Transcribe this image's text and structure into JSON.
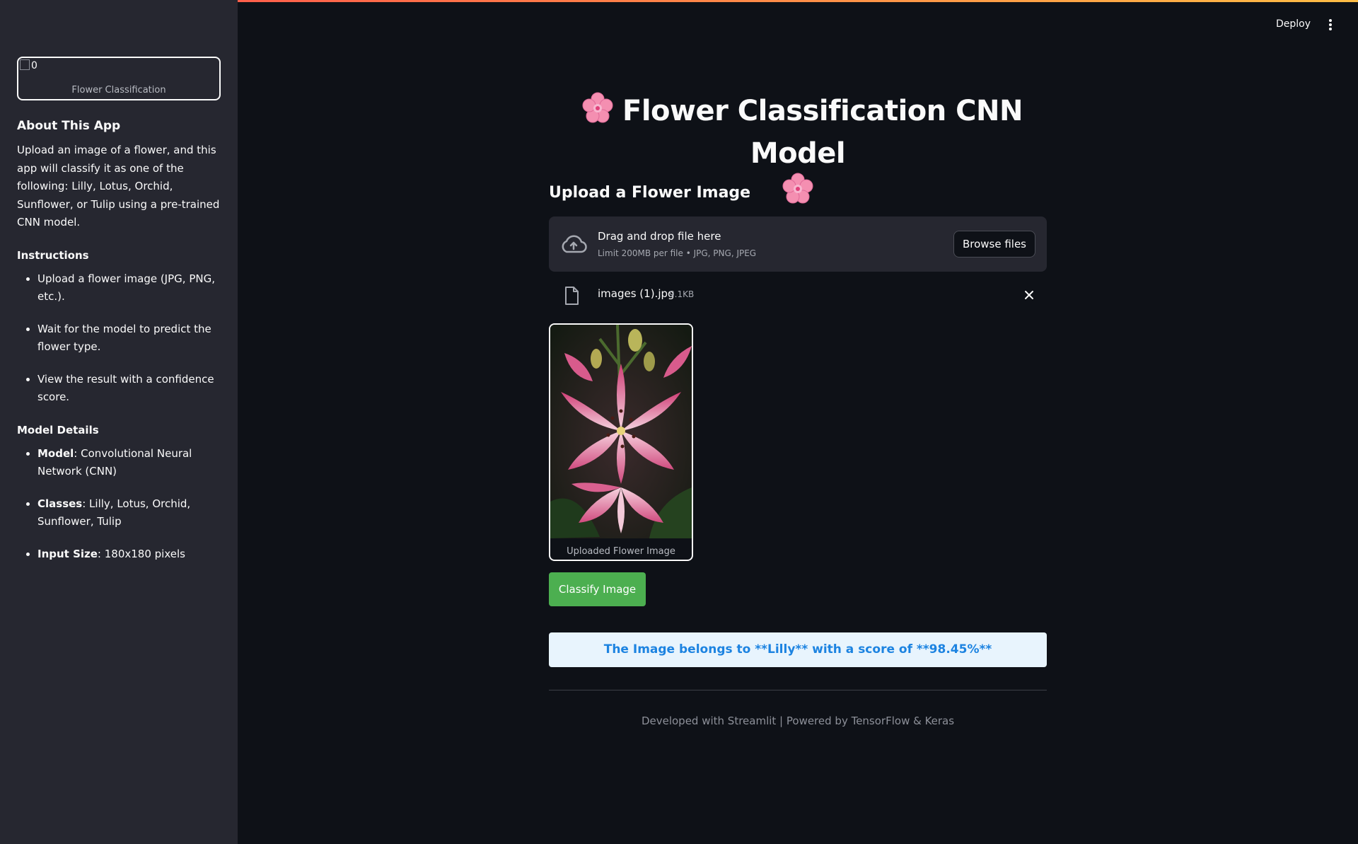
{
  "topbar": {
    "deploy_label": "Deploy"
  },
  "sidebar": {
    "logo": {
      "alt_text": "0",
      "caption": "Flower Classification"
    },
    "about": {
      "heading": "About This App",
      "text": "Upload an image of a flower, and this app will classify it as one of the following: Lilly, Lotus, Orchid, Sunflower, or Tulip using a pre-trained CNN model."
    },
    "instructions": {
      "heading": "Instructions",
      "items": [
        "Upload a flower image (JPG, PNG, etc.).",
        "Wait for the model to predict the flower type.",
        "View the result with a confidence score."
      ]
    },
    "model_details": {
      "heading": "Model Details",
      "items": [
        {
          "label": "Model",
          "value": ": Convolutional Neural Network (CNN)"
        },
        {
          "label": "Classes",
          "value": ": Lilly, Lotus, Orchid, Sunflower, Tulip"
        },
        {
          "label": "Input Size",
          "value": ": 180x180 pixels"
        }
      ]
    }
  },
  "main": {
    "title": "Flower Classification CNN Model",
    "upload_heading": "Upload a Flower Image",
    "uploader": {
      "drag_text": "Drag and drop file here",
      "limit_text": "Limit 200MB per file • JPG, PNG, JPEG",
      "browse_label": "Browse files"
    },
    "file": {
      "name": "images (1).jpg",
      "size": "9.1KB"
    },
    "image_caption": "Uploaded Flower Image",
    "classify_label": "Classify Image",
    "result_text": "The Image belongs to **Lilly** with a score of **98.45%**",
    "footer": "Developed with Streamlit | Powered by TensorFlow & Keras"
  },
  "colors": {
    "background": "#0e1117",
    "sidebar": "#262730",
    "classify_button": "#4caf50",
    "result_bg": "#e8f4fd",
    "result_text": "#1c83e1"
  }
}
